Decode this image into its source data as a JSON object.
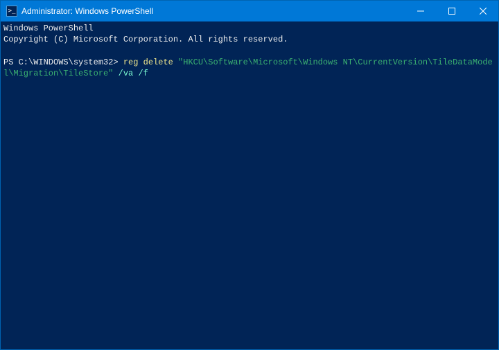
{
  "titlebar": {
    "icon_glyph": ">_",
    "title": "Administrator: Windows PowerShell",
    "minimize_label": "Minimize",
    "maximize_label": "Maximize",
    "close_label": "Close"
  },
  "terminal": {
    "banner_line1": "Windows PowerShell",
    "banner_line2": "Copyright (C) Microsoft Corporation. All rights reserved.",
    "prompt": "PS C:\\WINDOWS\\system32> ",
    "command_keyword": "reg delete ",
    "command_path": "\"HKCU\\Software\\Microsoft\\Windows NT\\CurrentVersion\\TileDataModel\\Migration\\TileStore\"",
    "command_flags": " /va /f"
  }
}
